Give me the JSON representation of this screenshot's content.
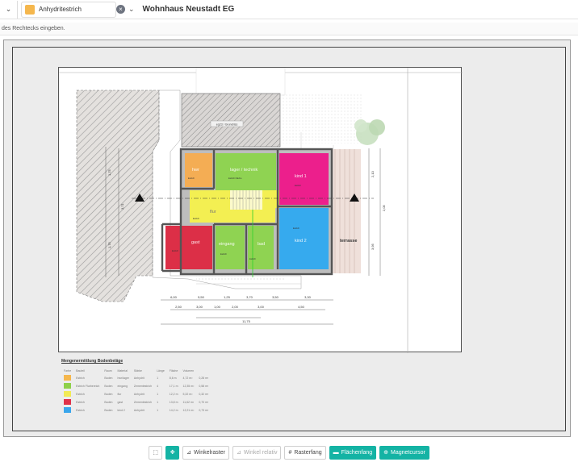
{
  "topbar": {
    "material_label": "Anhydritestrich",
    "material_color": "#f5b74d",
    "project_title": "Wohnhaus Neustadt EG"
  },
  "hint": {
    "text": "des Rechtecks eingeben."
  },
  "plan": {
    "badge_label": "eg23 / Grundriss",
    "rooms": {
      "hwr": "hwr",
      "lager": "lager / technik",
      "kind1": "kind 1",
      "flur": "flur",
      "gast": "gast",
      "eingang": "eingang",
      "bad": "bad",
      "kind2": "kind 2",
      "terrasse": "terrasse"
    },
    "dims_top": [
      "6,00",
      "5,50",
      "1,25",
      "3,70",
      "3,50",
      "3,30"
    ],
    "dims_bottom": [
      "2,50",
      "3,00",
      "1,00",
      "2,00",
      "3,00",
      "4,50"
    ],
    "dims_total": "11,75",
    "dims_left": [
      "1,75",
      "3,71",
      "1,75"
    ],
    "dims_right": [
      "2,10",
      "2,05",
      "3,95"
    ]
  },
  "legend": {
    "title": "Mengenermittlung Bodenbeläge",
    "headers": [
      "Farbe",
      "Bauteil",
      "Raum",
      "Material",
      "Stärke",
      "Länge",
      "Fläche",
      "Volumen"
    ],
    "rows": [
      {
        "color": "#f5b74d",
        "name": "Estrich",
        "layer": "Boden",
        "room": "hwr/lager",
        "material": "Anhydrit",
        "count": "1",
        "length": "8,6 m",
        "area": "4,72 m²",
        "volume": "0,28 m³"
      },
      {
        "color": "#8ed04a",
        "name": "Estrich Flurbereich",
        "layer": "Boden",
        "room": "eingang",
        "material": "Zementestrich",
        "count": "4",
        "length": "17,1 m",
        "area": "12,35 m²",
        "volume": "0,58 m³"
      },
      {
        "color": "#f2ea55",
        "name": "Estrich",
        "layer": "Boden",
        "room": "flur",
        "material": "Anhydrit",
        "count": "1",
        "length": "12,2 m",
        "area": "5,32 m²",
        "volume": "0,32 m³"
      },
      {
        "color": "#e0324a",
        "name": "Estrich",
        "layer": "Boden",
        "room": "gast",
        "material": "Zementestrich",
        "count": "1",
        "length": "13,8 m",
        "area": "11,62 m²",
        "volume": "0,70 m³"
      },
      {
        "color": "#3aa6ec",
        "name": "Estrich",
        "layer": "Boden",
        "room": "kind 2",
        "material": "Anhydrit",
        "count": "1",
        "length": "14,2 m",
        "area": "12,21 m²",
        "volume": "0,73 m³"
      }
    ]
  },
  "toolbar": {
    "winkelraster": "Winkelraster",
    "winkel_relativ": "Winkel relativ",
    "rasterfang": "Rasterfang",
    "flaechenfang": "Flächenfang",
    "magnetcursor": "Magnetcursor"
  }
}
